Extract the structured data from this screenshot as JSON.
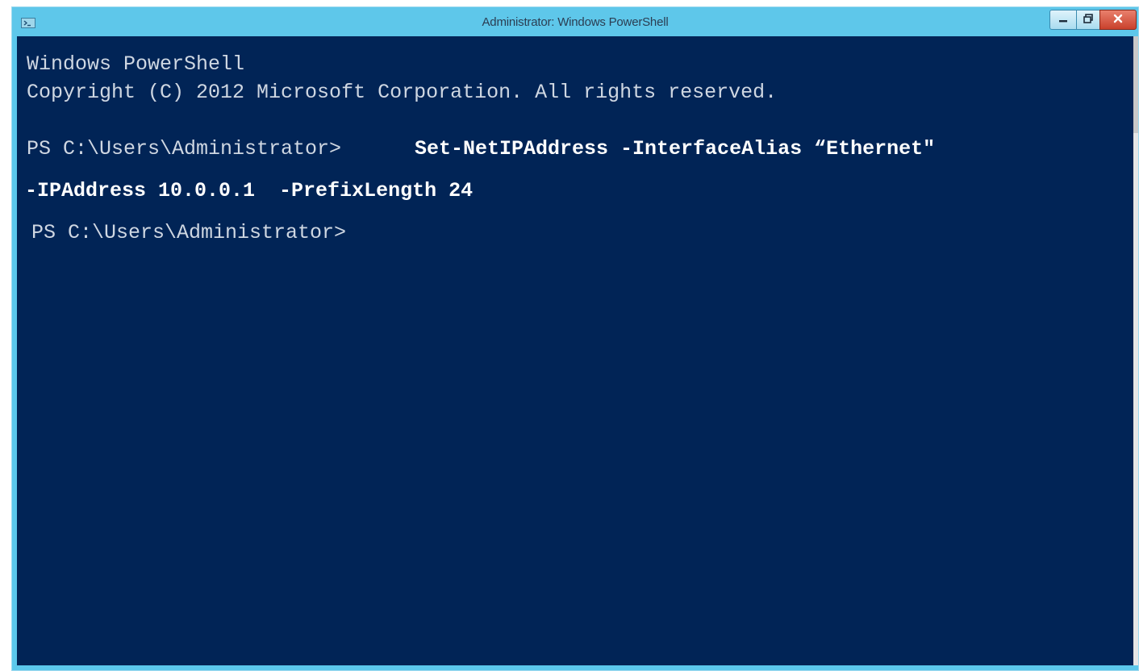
{
  "window": {
    "title": "Administrator: Windows PowerShell",
    "icon": "powershell-icon",
    "controls": {
      "minimize_icon": "minimize-icon",
      "maximize_icon": "restore-icon",
      "close_icon": "close-icon"
    }
  },
  "console": {
    "banner_line_1": "Windows PowerShell",
    "banner_line_2": "Copyright (C) 2012 Microsoft Corporation. All rights reserved.",
    "prompt_1": "PS C:\\Users\\Administrator>",
    "command_part_1": "Set-NetIPAddress -InterfaceAlias “Ethernet\"",
    "command_part_2": "-IPAddress 10.0.0.1  -PrefixLength 24",
    "prompt_2": "PS C:\\Users\\Administrator>"
  },
  "colors": {
    "console_background": "#012456",
    "titlebar": "#5ec7ea",
    "close_button": "#c9412c"
  }
}
